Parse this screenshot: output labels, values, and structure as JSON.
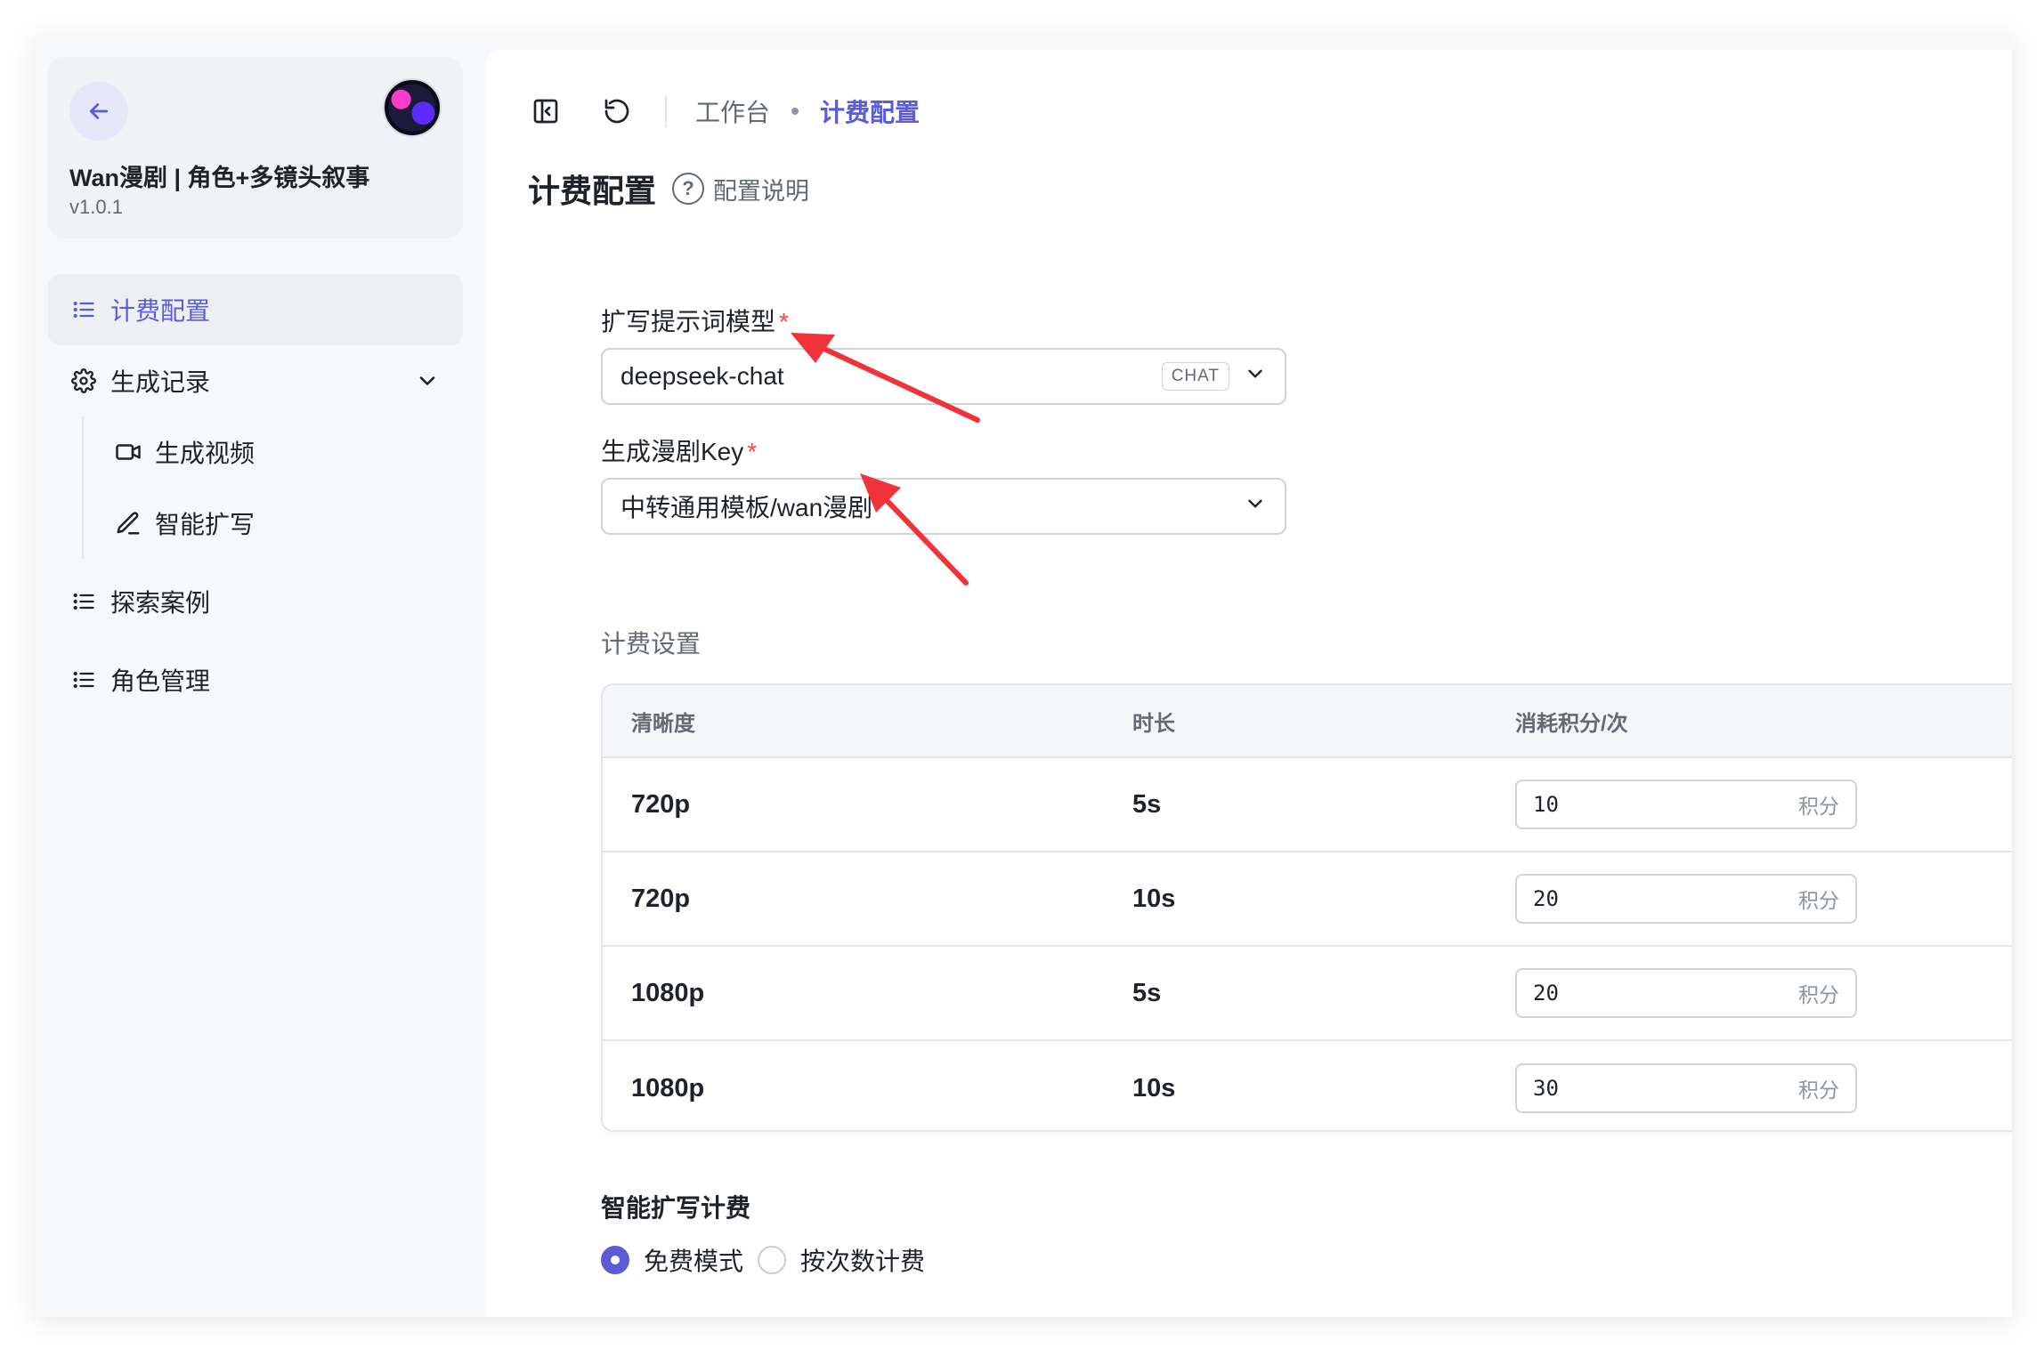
{
  "app": {
    "title": "Wan漫剧 | 角色+多镜头叙事",
    "version": "v1.0.1"
  },
  "sidebar": {
    "items": [
      {
        "label": "计费配置",
        "icon": "list-icon"
      },
      {
        "label": "生成记录",
        "icon": "gear-icon"
      },
      {
        "label": "生成视频",
        "icon": "video-camera-icon"
      },
      {
        "label": "智能扩写",
        "icon": "pencil-icon"
      },
      {
        "label": "探索案例",
        "icon": "list-icon"
      },
      {
        "label": "角色管理",
        "icon": "list-icon"
      }
    ]
  },
  "breadcrumb": {
    "home": "工作台",
    "current": "计费配置"
  },
  "page": {
    "title": "计费配置",
    "help": "配置说明"
  },
  "form": {
    "model": {
      "label": "扩写提示词模型",
      "required": "*",
      "value": "deepseek-chat",
      "tag": "CHAT"
    },
    "key": {
      "label": "生成漫剧Key",
      "required": "*",
      "value": "中转通用模板/wan漫剧"
    }
  },
  "billing": {
    "title": "计费设置",
    "headers": [
      "清晰度",
      "时长",
      "消耗积分/次"
    ],
    "unit": "积分",
    "rows": [
      {
        "res": "720p",
        "dur": "5s",
        "points": "10"
      },
      {
        "res": "720p",
        "dur": "10s",
        "points": "20"
      },
      {
        "res": "1080p",
        "dur": "5s",
        "points": "20"
      },
      {
        "res": "1080p",
        "dur": "10s",
        "points": "30"
      }
    ]
  },
  "expand_billing": {
    "title": "智能扩写计费",
    "options": [
      "免费模式",
      "按次数计费"
    ],
    "selected": "免费模式"
  },
  "colors": {
    "accent": "#5b5bd6",
    "annotation_arrow": "#f0333a"
  }
}
